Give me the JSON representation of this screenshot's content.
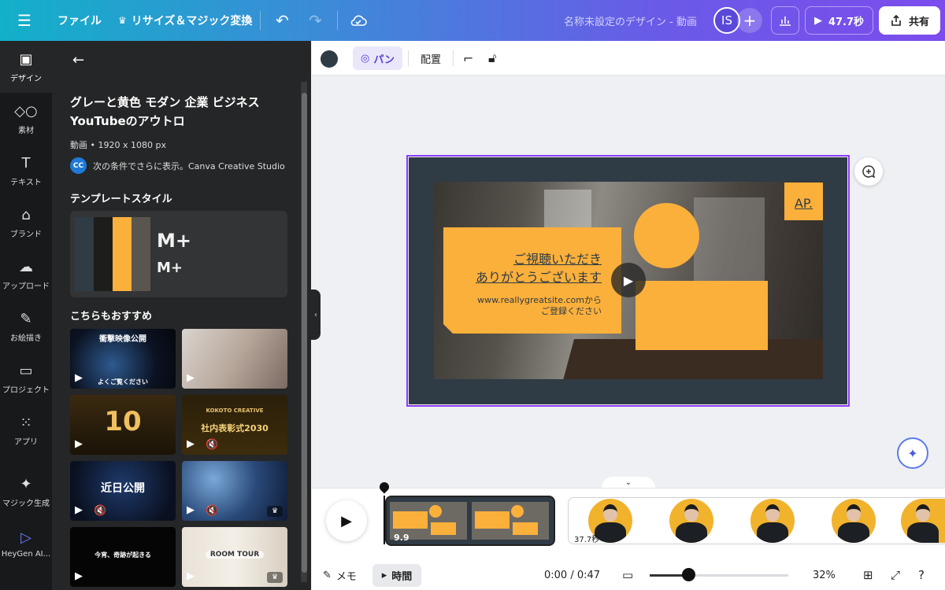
{
  "topbar": {
    "menu_icon": "hamburger-icon",
    "file_label": "ファイル",
    "resize_label": "リサイズ＆マジック変換",
    "title": "名称未設定のデザイン - 動画",
    "avatar_initials": "IS",
    "play_label": "47.7秒",
    "share_label": "共有"
  },
  "rail": {
    "items": [
      {
        "label": "デザイン",
        "icon": "layout-icon"
      },
      {
        "label": "素材",
        "icon": "shapes-icon"
      },
      {
        "label": "テキスト",
        "icon": "text-icon"
      },
      {
        "label": "ブランド",
        "icon": "brand-icon"
      },
      {
        "label": "アップロード",
        "icon": "upload-icon"
      },
      {
        "label": "お絵描き",
        "icon": "draw-icon"
      },
      {
        "label": "プロジェクト",
        "icon": "folder-icon"
      },
      {
        "label": "アプリ",
        "icon": "apps-icon"
      },
      {
        "label": "マジック生成",
        "icon": "magic-icon"
      },
      {
        "label": "HeyGen AI...",
        "icon": "heygen-icon"
      }
    ]
  },
  "panel": {
    "template_title": "グレーと黄色 モダン 企業 ビジネス YouTubeのアウトロ",
    "meta": "動画 • 1920 x 1080 px",
    "creator_badge": "CC",
    "creator_text": "次の条件でさらに表示。Canva Creative Studio",
    "style_section": "テンプレートスタイル",
    "style_fonts": [
      "M+",
      "M+"
    ],
    "style_colors": [
      "#2f3b45",
      "#1d1d1b",
      "#fbb03b",
      "#5a564f"
    ],
    "recommend_section": "こちらもおすすめ",
    "thumbs": [
      {
        "title": "衝撃映像公開",
        "sub": "よくご覧ください",
        "bg": "dark-sky"
      },
      {
        "title": "",
        "sub": "",
        "bg": "keyboard"
      },
      {
        "title": "10",
        "sub": "",
        "bg": "gold"
      },
      {
        "title": "社内表彰式2030",
        "sub": "KOKOTO CREATIVE",
        "bg": "gold-dark"
      },
      {
        "title": "近日公開",
        "sub": "",
        "bg": "navy"
      },
      {
        "title": "",
        "sub": "",
        "bg": "bokeh"
      },
      {
        "title": "今宵、奇跡が起きる",
        "sub": "",
        "bg": "black"
      },
      {
        "title": "ROOM TOUR",
        "sub": "",
        "bg": "room"
      }
    ]
  },
  "toolbar": {
    "pan_label": "パン",
    "arrange_label": "配置"
  },
  "design": {
    "ap_text": "AP.",
    "line1": "ご視聴いただき",
    "line2": "ありがとうございます",
    "sub1": "www.reallygreatsite.comから",
    "sub2": "ご登録ください"
  },
  "timeline": {
    "clip1_duration": "9.9",
    "clip2_duration": "37.7秒"
  },
  "bottombar": {
    "memo_label": "メモ",
    "time_label": "時間",
    "timecode": "0:00 / 0:47",
    "zoom": "32%",
    "zoom_level": 0.28
  }
}
